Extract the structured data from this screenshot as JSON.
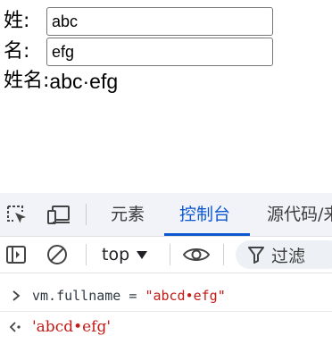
{
  "form": {
    "last_name_label": "姓:",
    "last_name_value": "abc",
    "first_name_label": "名:",
    "first_name_value": "efg",
    "full_name_label": "姓名:",
    "full_name_value": "abc·efg"
  },
  "devtools": {
    "tabs": [
      {
        "label": "元素",
        "active": false
      },
      {
        "label": "控制台",
        "active": true
      },
      {
        "label": "源代码/来",
        "active": false
      }
    ],
    "context_selector": "top",
    "filter_label": "过滤",
    "accent_color": "#0b57d0",
    "console": {
      "input_prefix": "vm.fullname = ",
      "input_string": "\"abcd•efg\"",
      "output": "'abcd•efg'"
    }
  }
}
